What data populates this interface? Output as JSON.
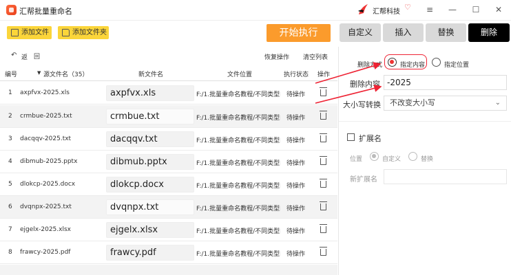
{
  "app": {
    "title": "汇帮批量重命名",
    "brand": "汇帮科技"
  },
  "window_controls": {
    "menu": "≡",
    "minimize": "—",
    "maximize": "☐",
    "close": "✕"
  },
  "toolbar": {
    "add_file": "添加文件",
    "add_folder": "添加文件夹",
    "start": "开始执行",
    "tabs": [
      "自定义",
      "插入",
      "替换",
      "删除"
    ],
    "active_tab": "删除"
  },
  "subtoolbar": {
    "back": "返",
    "redo": "回",
    "restore": "恢复操作",
    "clear": "清空列表"
  },
  "table": {
    "headers": {
      "index": "编号",
      "source": "源文件名（35）",
      "new_name": "新文件名",
      "location": "文件位置",
      "status": "执行状态",
      "action": "操作"
    },
    "rows": [
      {
        "index": "1",
        "source": "axpfvx-2025.xls",
        "new_name": "axpfvx.xls",
        "location": "F:/1.批量重命名教程/不同类型的文",
        "status": "待操作"
      },
      {
        "index": "2",
        "source": "crmbue-2025.txt",
        "new_name": "crmbue.txt",
        "location": "F:/1.批量重命名教程/不同类型的文",
        "status": "待操作"
      },
      {
        "index": "3",
        "source": "dacqqv-2025.txt",
        "new_name": "dacqqv.txt",
        "location": "F:/1.批量重命名教程/不同类型的文",
        "status": "待操作"
      },
      {
        "index": "4",
        "source": "dibmub-2025.pptx",
        "new_name": "dibmub.pptx",
        "location": "F:/1.批量重命名教程/不同类型的文",
        "status": "待操作"
      },
      {
        "index": "5",
        "source": "dlokcp-2025.docx",
        "new_name": "dlokcp.docx",
        "location": "F:/1.批量重命名教程/不同类型的文",
        "status": "待操作"
      },
      {
        "index": "6",
        "source": "dvqnpx-2025.txt",
        "new_name": "dvqnpx.txt",
        "location": "F:/1.批量重命名教程/不同类型的文",
        "status": "待操作"
      },
      {
        "index": "7",
        "source": "ejgelx-2025.xlsx",
        "new_name": "ejgelx.xlsx",
        "location": "F:/1.批量重命名教程/不同类型的文",
        "status": "待操作"
      },
      {
        "index": "8",
        "source": "frawcy-2025.pdf",
        "new_name": "frawcy.pdf",
        "location": "F:/1.批量重命名教程/不同类型的文",
        "status": "待操作"
      }
    ]
  },
  "panel": {
    "delete_mode_label": "删除方式",
    "mode_content": "指定内容",
    "mode_position": "指定位置",
    "delete_content_label": "删除内容",
    "delete_content_value": "-2025",
    "case_label": "大小写转换",
    "case_value": "不改变大小写",
    "ext_label": "扩展名",
    "position_label": "位置",
    "custom_label": "自定义",
    "replace_label": "替换",
    "new_ext_label": "新扩展名",
    "new_ext_value": ""
  },
  "colors": {
    "accent_yellow": "#fbd53a",
    "start_orange": "#fb9b2c",
    "highlight_red": "#e23",
    "active_tab": "#000000"
  }
}
